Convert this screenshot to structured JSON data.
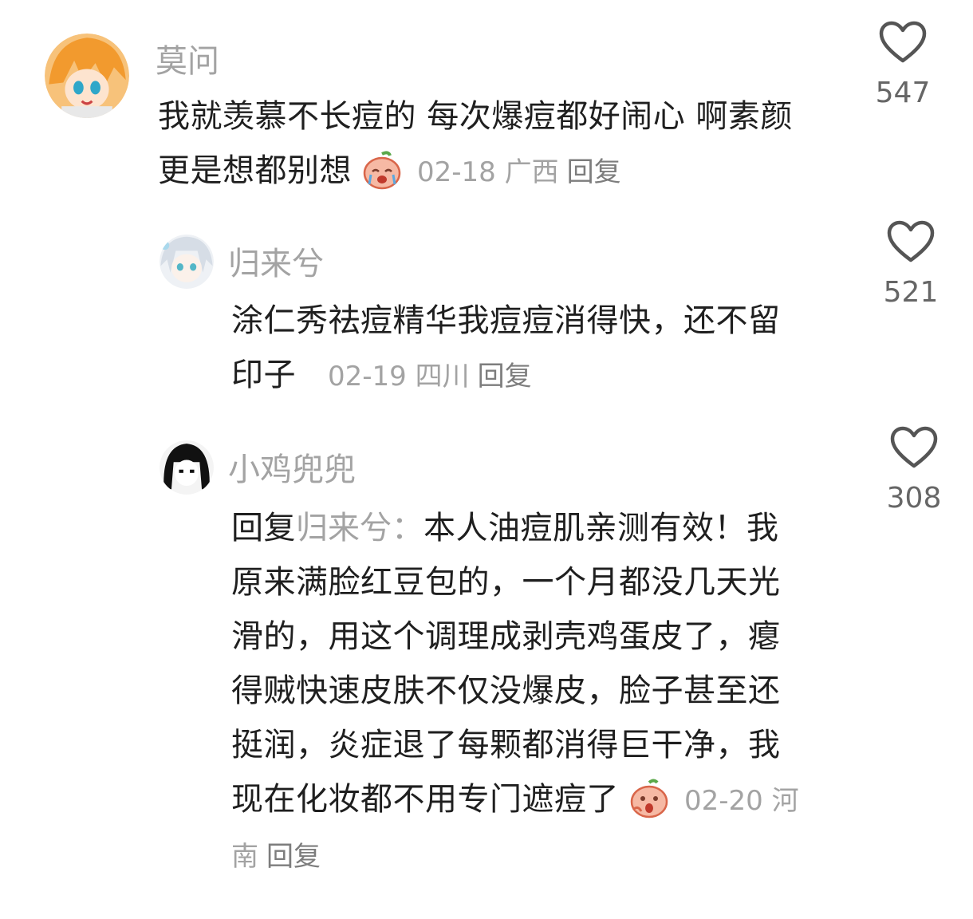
{
  "comments": [
    {
      "username": "莫问",
      "text": "我就羡慕不长痘的 每次爆痘都好闹心 啊素颜更是想都别想",
      "emoji": "crying-face-emoji",
      "date": "02-18",
      "location": "广西",
      "reply_label": "回复",
      "likes": "547"
    },
    {
      "username": "归来兮",
      "text": "涂仁秀祛痘精华我痘痘消得快，还不留印子",
      "date": "02-19",
      "location": "四川",
      "reply_label": "回复",
      "likes": "521"
    },
    {
      "username": "小鸡兜兜",
      "reply_prefix": "回复",
      "reply_target": "归来兮：",
      "text": "本人油痘肌亲测有效！我原来满脸红豆包的，一个月都没几天光滑的，用这个调理成剥壳鸡蛋皮了，瘪得贼快速皮肤不仅没爆皮，脸子甚至还挺润，炎症退了每颗都消得巨干净，我现在化妆都不用专门遮痘了",
      "emoji": "shocked-face-emoji",
      "date": "02-20",
      "location": "河南",
      "reply_label": "回复",
      "likes": "308"
    }
  ],
  "colors": {
    "text": "#1f1f1f",
    "muted": "#a3a3a3",
    "reply": "#7d7d7d",
    "heart": "#555555"
  }
}
